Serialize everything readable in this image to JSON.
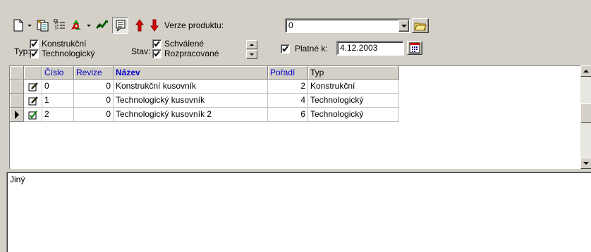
{
  "toolbar": {
    "icons": [
      "new-doc-icon",
      "copy-doc-icon",
      "tree-list-icon",
      "recycle-icon",
      "arrows-icon",
      "comment-icon",
      "arrow-up-icon",
      "arrow-down-icon",
      "open-folder-icon"
    ],
    "product_version_label": "Verze produktu:",
    "product_version_value": "0"
  },
  "filters": {
    "type_label": "Typ:",
    "type_options": [
      {
        "label": "Konstrukční",
        "checked": true
      },
      {
        "label": "Technologický",
        "checked": true
      }
    ],
    "state_label": "Stav:",
    "state_options": [
      {
        "label": "Schválené",
        "checked": true
      },
      {
        "label": "Rozpracované",
        "checked": true
      }
    ],
    "valid_label": "Platné k:",
    "valid_checked": true,
    "valid_date": "4.12.2003"
  },
  "grid": {
    "columns": [
      "Číslo",
      "Revize",
      "Název",
      "Pořadí",
      "Typ"
    ],
    "rows": [
      {
        "cislo": "0",
        "revize": "0",
        "nazev": "Konstrukční kusovník",
        "poradi": "2",
        "typ": "Konstrukční",
        "current": false
      },
      {
        "cislo": "1",
        "revize": "0",
        "nazev": "Technologický kusovník",
        "poradi": "4",
        "typ": "Technologický",
        "current": false
      },
      {
        "cislo": "2",
        "revize": "0",
        "nazev": "Technologický kusovník 2",
        "poradi": "6",
        "typ": "Technologický",
        "current": true
      }
    ]
  },
  "memo": {
    "text": "Jiný"
  },
  "colors": {
    "face": "#d4d0c8",
    "header_blue": "#0000c8"
  }
}
